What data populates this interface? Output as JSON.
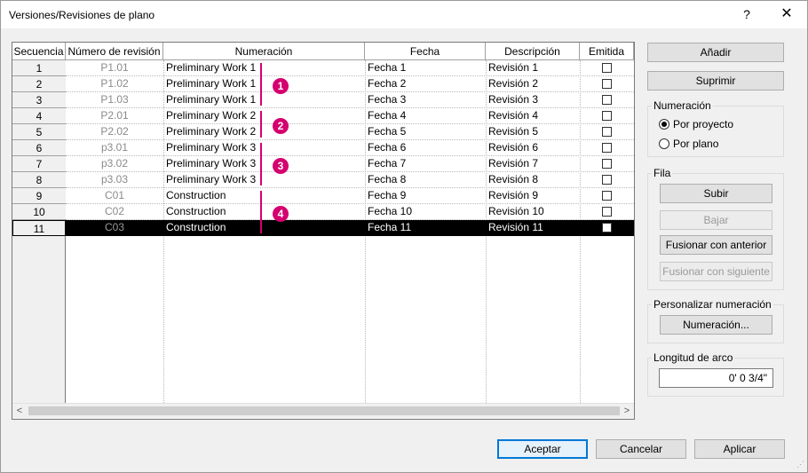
{
  "window": {
    "title": "Versiones/Revisiones de plano",
    "help_label": "?",
    "close_label": "✕"
  },
  "table": {
    "columns": [
      "Secuencia",
      "Número de revisión",
      "Numeración",
      "Fecha",
      "Descripción",
      "Emitida"
    ],
    "rows": [
      {
        "seq": "1",
        "rev": "P1.01",
        "num": "Preliminary Work 1",
        "fecha": "Fecha 1",
        "desc": "Revisión 1",
        "emitida": false
      },
      {
        "seq": "2",
        "rev": "P1.02",
        "num": "Preliminary Work 1",
        "fecha": "Fecha 2",
        "desc": "Revisión 2",
        "emitida": false
      },
      {
        "seq": "3",
        "rev": "P1.03",
        "num": "Preliminary Work 1",
        "fecha": "Fecha 3",
        "desc": "Revisión 3",
        "emitida": false
      },
      {
        "seq": "4",
        "rev": "P2.01",
        "num": "Preliminary Work 2",
        "fecha": "Fecha 4",
        "desc": "Revisión 4",
        "emitida": false
      },
      {
        "seq": "5",
        "rev": "P2.02",
        "num": "Preliminary Work 2",
        "fecha": "Fecha 5",
        "desc": "Revisión 5",
        "emitida": false
      },
      {
        "seq": "6",
        "rev": "p3.01",
        "num": "Preliminary Work 3",
        "fecha": "Fecha 6",
        "desc": "Revisión 6",
        "emitida": false
      },
      {
        "seq": "7",
        "rev": "p3.02",
        "num": "Preliminary Work 3",
        "fecha": "Fecha 7",
        "desc": "Revisión 7",
        "emitida": false
      },
      {
        "seq": "8",
        "rev": "p3.03",
        "num": "Preliminary Work 3",
        "fecha": "Fecha 8",
        "desc": "Revisión 8",
        "emitida": false
      },
      {
        "seq": "9",
        "rev": "C01",
        "num": "Construction",
        "fecha": "Fecha 9",
        "desc": "Revisión 9",
        "emitida": false
      },
      {
        "seq": "10",
        "rev": "C02",
        "num": "Construction",
        "fecha": "Fecha 10",
        "desc": "Revisión 10",
        "emitida": false
      },
      {
        "seq": "11",
        "rev": "C03",
        "num": "Construction",
        "fecha": "Fecha 11",
        "desc": "Revisión 11",
        "emitida": false
      }
    ],
    "selected_row": "11",
    "callouts": [
      "1",
      "2",
      "3",
      "4"
    ],
    "callout_color": "#d4006f"
  },
  "buttons": {
    "add": "Añadir",
    "delete": "Suprimir",
    "ok": "Aceptar",
    "cancel": "Cancelar",
    "apply": "Aplicar"
  },
  "numeracion": {
    "label": "Numeración",
    "by_project": "Por proyecto",
    "by_sheet": "Por plano",
    "selected": "Por proyecto"
  },
  "fila": {
    "label": "Fila",
    "up": "Subir",
    "down": "Bajar",
    "merge_prev": "Fusionar con anterior",
    "merge_next": "Fusionar con siguiente"
  },
  "custom": {
    "label": "Personalizar numeración",
    "button": "Numeración..."
  },
  "arc": {
    "label": "Longitud de arco",
    "value": "0'  0 3/4\""
  },
  "scroll": {
    "left": "<",
    "right": ">"
  }
}
